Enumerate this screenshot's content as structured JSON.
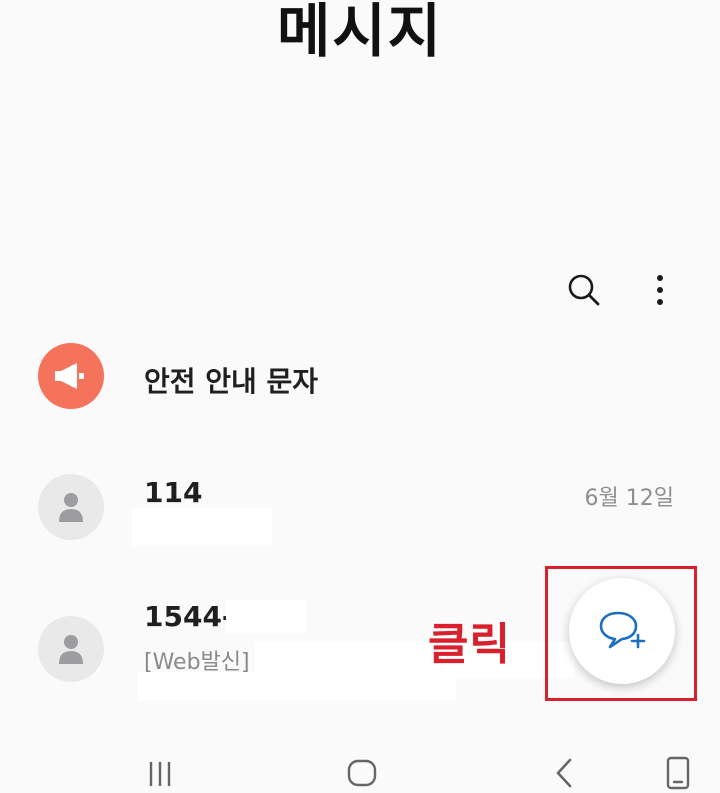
{
  "header": {
    "title": "메시지"
  },
  "toolbar": {
    "search_icon": "search-icon",
    "more_icon": "more-vertical-icon"
  },
  "conversations": [
    {
      "name": "안전 안내 문자",
      "avatar": "megaphone-icon",
      "avatar_color": "#f4735a"
    },
    {
      "name": "114",
      "date": "6월 12일",
      "avatar": "person-icon"
    },
    {
      "name": "1544-",
      "preview": "[Web발신]",
      "avatar": "person-icon"
    }
  ],
  "annotation": {
    "label": "클릭",
    "color": "#d9202c"
  },
  "fab": {
    "icon": "new-message-icon",
    "accent": "#1e6fc2"
  },
  "navbar": {
    "recents_icon": "recents-icon",
    "home_icon": "home-icon",
    "back_icon": "back-icon",
    "keyboard_icon": "keyboard-toggle-icon"
  }
}
